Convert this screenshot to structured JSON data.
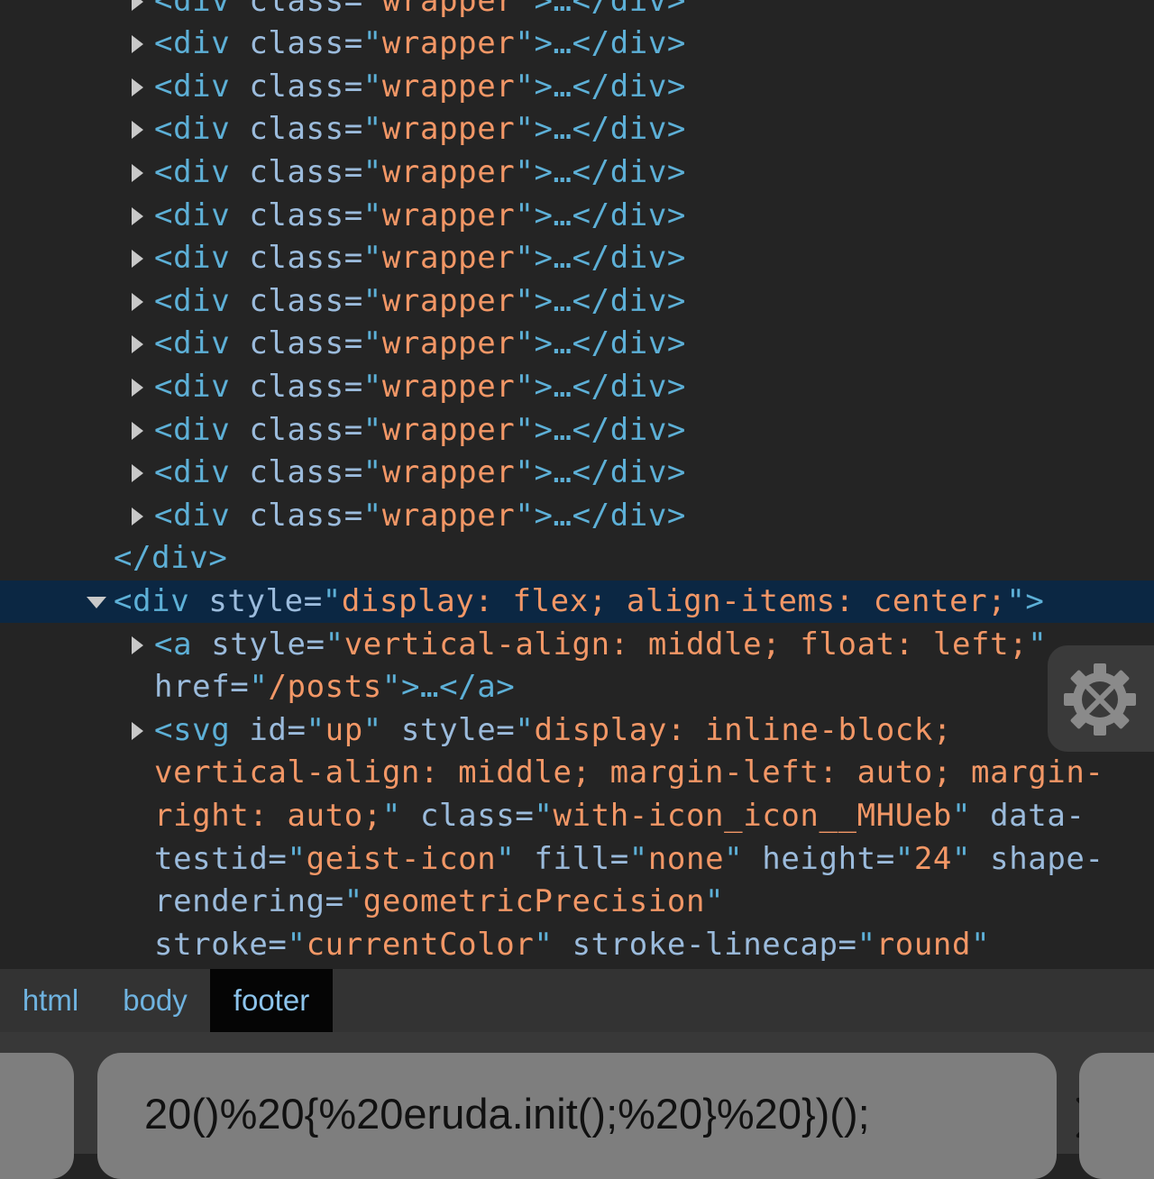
{
  "elements_tree": {
    "lines": [
      {
        "tokens": [
          [
            "t",
            "<div"
          ],
          [
            "a",
            " class="
          ],
          [
            "p",
            "\""
          ],
          [
            "v",
            "wrapper"
          ],
          [
            "p",
            "\""
          ],
          [
            "t",
            ">…</div>"
          ]
        ]
      },
      {
        "tokens": [
          [
            "t",
            "<div"
          ],
          [
            "a",
            " class="
          ],
          [
            "p",
            "\""
          ],
          [
            "v",
            "wrapper"
          ],
          [
            "p",
            "\""
          ],
          [
            "t",
            ">…</div>"
          ]
        ]
      },
      {
        "tokens": [
          [
            "t",
            "<div"
          ],
          [
            "a",
            " class="
          ],
          [
            "p",
            "\""
          ],
          [
            "v",
            "wrapper"
          ],
          [
            "p",
            "\""
          ],
          [
            "t",
            ">…</div>"
          ]
        ]
      },
      {
        "tokens": [
          [
            "t",
            "<div"
          ],
          [
            "a",
            " class="
          ],
          [
            "p",
            "\""
          ],
          [
            "v",
            "wrapper"
          ],
          [
            "p",
            "\""
          ],
          [
            "t",
            ">…</div>"
          ]
        ]
      },
      {
        "tokens": [
          [
            "t",
            "<div"
          ],
          [
            "a",
            " class="
          ],
          [
            "p",
            "\""
          ],
          [
            "v",
            "wrapper"
          ],
          [
            "p",
            "\""
          ],
          [
            "t",
            ">…</div>"
          ]
        ]
      },
      {
        "tokens": [
          [
            "t",
            "<div"
          ],
          [
            "a",
            " class="
          ],
          [
            "p",
            "\""
          ],
          [
            "v",
            "wrapper"
          ],
          [
            "p",
            "\""
          ],
          [
            "t",
            ">…</div>"
          ]
        ]
      },
      {
        "tokens": [
          [
            "t",
            "<div"
          ],
          [
            "a",
            " class="
          ],
          [
            "p",
            "\""
          ],
          [
            "v",
            "wrapper"
          ],
          [
            "p",
            "\""
          ],
          [
            "t",
            ">…</div>"
          ]
        ]
      },
      {
        "tokens": [
          [
            "t",
            "<div"
          ],
          [
            "a",
            " class="
          ],
          [
            "p",
            "\""
          ],
          [
            "v",
            "wrapper"
          ],
          [
            "p",
            "\""
          ],
          [
            "t",
            ">…</div>"
          ]
        ]
      },
      {
        "tokens": [
          [
            "t",
            "<div"
          ],
          [
            "a",
            " class="
          ],
          [
            "p",
            "\""
          ],
          [
            "v",
            "wrapper"
          ],
          [
            "p",
            "\""
          ],
          [
            "t",
            ">…</div>"
          ]
        ]
      },
      {
        "tokens": [
          [
            "t",
            "<div"
          ],
          [
            "a",
            " class="
          ],
          [
            "p",
            "\""
          ],
          [
            "v",
            "wrapper"
          ],
          [
            "p",
            "\""
          ],
          [
            "t",
            ">…</div>"
          ]
        ]
      },
      {
        "tokens": [
          [
            "t",
            "<div"
          ],
          [
            "a",
            " class="
          ],
          [
            "p",
            "\""
          ],
          [
            "v",
            "wrapper"
          ],
          [
            "p",
            "\""
          ],
          [
            "t",
            ">…</div>"
          ]
        ]
      },
      {
        "tokens": [
          [
            "t",
            "<div"
          ],
          [
            "a",
            " class="
          ],
          [
            "p",
            "\""
          ],
          [
            "v",
            "wrapper"
          ],
          [
            "p",
            "\""
          ],
          [
            "t",
            ">…</div>"
          ]
        ]
      },
      {
        "tokens": [
          [
            "t",
            "<div"
          ],
          [
            "a",
            " class="
          ],
          [
            "p",
            "\""
          ],
          [
            "v",
            "wrapper"
          ],
          [
            "p",
            "\""
          ],
          [
            "t",
            ">…</div>"
          ]
        ]
      },
      {
        "tokens": [
          [
            "t",
            "</div>"
          ]
        ]
      },
      {
        "tokens": [
          [
            "t",
            "<div"
          ],
          [
            "a",
            " style="
          ],
          [
            "p",
            "\""
          ],
          [
            "v",
            "display: flex; align-items: center;"
          ],
          [
            "p",
            "\""
          ],
          [
            "t",
            ">"
          ]
        ]
      },
      {
        "tokens": [
          [
            "t",
            "<a"
          ],
          [
            "a",
            " style="
          ],
          [
            "p",
            "\""
          ],
          [
            "v",
            "vertical-align: middle; float: left;"
          ],
          [
            "p",
            "\""
          ]
        ]
      },
      {
        "tokens": [
          [
            "a",
            "href="
          ],
          [
            "p",
            "\""
          ],
          [
            "v",
            "/posts"
          ],
          [
            "p",
            "\""
          ],
          [
            "t",
            ">…</a>"
          ]
        ]
      },
      {
        "tokens": [
          [
            "t",
            "<svg"
          ],
          [
            "a",
            " id="
          ],
          [
            "p",
            "\""
          ],
          [
            "v",
            "up"
          ],
          [
            "p",
            "\""
          ],
          [
            "a",
            " style="
          ],
          [
            "p",
            "\""
          ],
          [
            "v",
            "display: inline-block;"
          ]
        ]
      },
      {
        "tokens": [
          [
            "v",
            "vertical-align: middle; margin-left: auto; margin-"
          ]
        ]
      },
      {
        "tokens": [
          [
            "v",
            "right: auto;"
          ],
          [
            "p",
            "\""
          ],
          [
            "a",
            " class="
          ],
          [
            "p",
            "\""
          ],
          [
            "v",
            "with-icon_icon__MHUeb"
          ],
          [
            "p",
            "\""
          ],
          [
            "a",
            " data-"
          ]
        ]
      },
      {
        "tokens": [
          [
            "a",
            "testid="
          ],
          [
            "p",
            "\""
          ],
          [
            "v",
            "geist-icon"
          ],
          [
            "p",
            "\""
          ],
          [
            "a",
            " fill="
          ],
          [
            "p",
            "\""
          ],
          [
            "v",
            "none"
          ],
          [
            "p",
            "\""
          ],
          [
            "a",
            " height="
          ],
          [
            "p",
            "\""
          ],
          [
            "v",
            "24"
          ],
          [
            "p",
            "\""
          ],
          [
            "a",
            " shape-"
          ]
        ]
      },
      {
        "tokens": [
          [
            "a",
            "rendering="
          ],
          [
            "p",
            "\""
          ],
          [
            "v",
            "geometricPrecision"
          ],
          [
            "p",
            "\""
          ]
        ]
      },
      {
        "tokens": [
          [
            "a",
            "stroke="
          ],
          [
            "p",
            "\""
          ],
          [
            "v",
            "currentColor"
          ],
          [
            "p",
            "\""
          ],
          [
            "a",
            " stroke-linecap="
          ],
          [
            "p",
            "\""
          ],
          [
            "v",
            "round"
          ],
          [
            "p",
            "\""
          ]
        ]
      }
    ]
  },
  "breadcrumbs": {
    "items": [
      {
        "label": "html",
        "active": false
      },
      {
        "label": "body",
        "active": false
      },
      {
        "label": "footer",
        "active": true
      }
    ]
  },
  "address_bar": {
    "url_text": "20()%20{%20eruda.init();%20}%20})();"
  },
  "icons": {
    "close": "close-icon",
    "settings": "settings-gear-tools-icon"
  }
}
